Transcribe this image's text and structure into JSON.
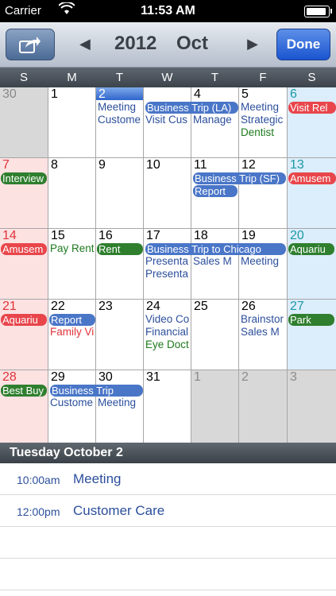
{
  "status": {
    "carrier": "Carrier",
    "time": "11:53 AM",
    "battery_level": 0.9
  },
  "nav": {
    "year": "2012",
    "month": "Oct",
    "done_label": "Done",
    "prev_icon": "◀",
    "next_icon": "▶"
  },
  "weekdays": [
    "S",
    "M",
    "T",
    "W",
    "T",
    "F",
    "S"
  ],
  "calendar": {
    "days": [
      {
        "num": "30",
        "type": "other"
      },
      {
        "num": "1"
      },
      {
        "num": "2",
        "type": "sel"
      },
      {
        "num": "4"
      },
      {
        "num": "5"
      },
      {
        "num": "6"
      },
      {
        "num": "7"
      },
      {
        "num": "8"
      },
      {
        "num": "9"
      },
      {
        "num": "10"
      },
      {
        "num": "11"
      },
      {
        "num": "12"
      },
      {
        "num": "13"
      },
      {
        "num": "14"
      },
      {
        "num": "15"
      },
      {
        "num": "16"
      },
      {
        "num": "17"
      },
      {
        "num": "18"
      },
      {
        "num": "19"
      },
      {
        "num": "20"
      },
      {
        "num": "21"
      },
      {
        "num": "22"
      },
      {
        "num": "23"
      },
      {
        "num": "24"
      },
      {
        "num": "25"
      },
      {
        "num": "26"
      },
      {
        "num": "27"
      },
      {
        "num": "28"
      },
      {
        "num": "29"
      },
      {
        "num": "30"
      },
      {
        "num": "31"
      },
      {
        "num": "1",
        "type": "other"
      },
      {
        "num": "2",
        "type": "other"
      },
      {
        "num": "3",
        "type": "other"
      }
    ],
    "events": {
      "e2a": "Meeting",
      "e2b": "Custome",
      "e3a": "Business Trip (LA)",
      "e3b": "Visit Cus",
      "e4b": "Manage",
      "e5a": "Meeting",
      "e5b": "Strategic",
      "e5c": "Dentist",
      "e6a": "Visit Rel",
      "e7a": "Interview",
      "e11a": "Business Trip (SF)",
      "e11b": "Report",
      "e13a": "Amusem",
      "e14a": "Amusem",
      "e15a": "Pay Rent",
      "e16a": "Rent",
      "e17a": "Business Trip to Chicago",
      "e17b": "Presenta",
      "e17c": "Presenta",
      "e18b": "Sales M",
      "e19b": "Meeting",
      "e20a": "Aquariu",
      "e21a": "Aquariu",
      "e22a": "Report",
      "e22b": "Family Vi",
      "e24a": "Video Co",
      "e24b": "Financial",
      "e24c": "Eye Doct",
      "e26a": "Brainstor",
      "e26b": "Sales M",
      "e27a": "Park",
      "e28a": "Best Buy",
      "e29a": "Business Trip",
      "e29b": "Custome",
      "e30b": "Meeting"
    }
  },
  "selected": {
    "header": "Tuesday October 2",
    "items": [
      {
        "time": "10:00am",
        "title": "Meeting"
      },
      {
        "time": "12:00pm",
        "title": "Customer Care"
      }
    ]
  }
}
